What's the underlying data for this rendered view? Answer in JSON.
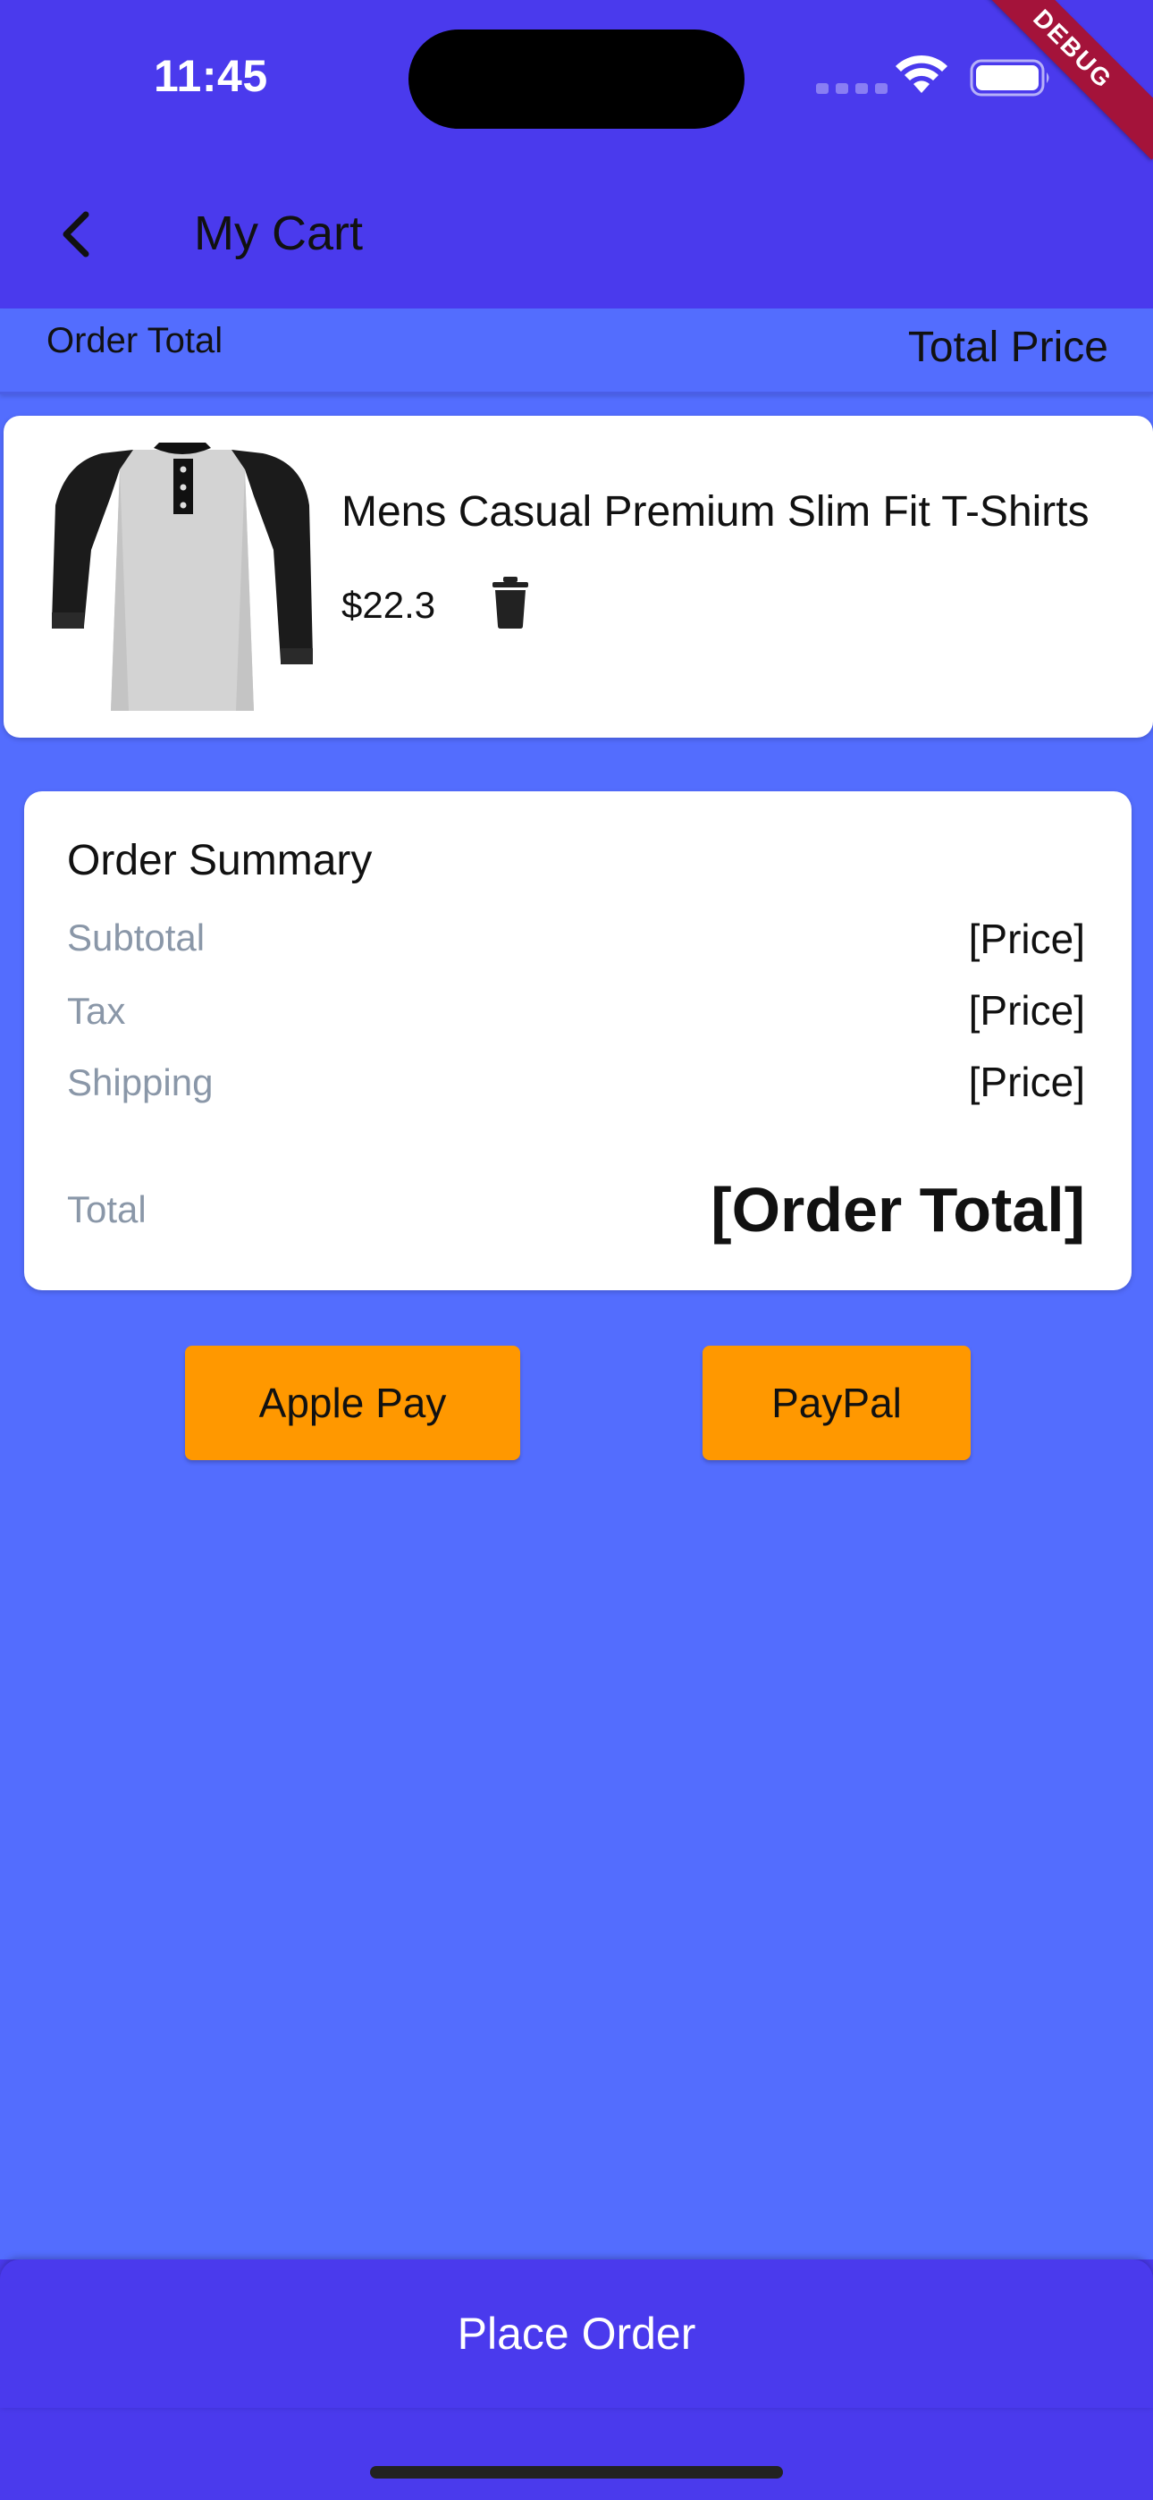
{
  "status_bar": {
    "time": "11:45"
  },
  "debug_banner": "DEBUG",
  "header": {
    "title": "My Cart"
  },
  "total_strip": {
    "left_label": "Order Total",
    "right_label": "Total Price"
  },
  "cart_items": [
    {
      "name": "Mens Casual Premium Slim Fit T-Shirts",
      "price": "$22.3",
      "image_icon": "tshirt-image"
    }
  ],
  "summary": {
    "title": "Order Summary",
    "rows": [
      {
        "label": "Subtotal",
        "value": "[Price]"
      },
      {
        "label": "Tax",
        "value": "[Price]"
      },
      {
        "label": "Shipping",
        "value": "[Price]"
      }
    ],
    "total_label": "Total",
    "total_value": "[Order Total]"
  },
  "payment": {
    "apple_pay": "Apple Pay",
    "paypal": "PayPal"
  },
  "footer": {
    "place_order": "Place Order"
  },
  "colors": {
    "appbar": "#4a3aed",
    "background": "#536dfe",
    "pay_button": "#ff9800",
    "debug_ribbon": "#a4133a"
  }
}
